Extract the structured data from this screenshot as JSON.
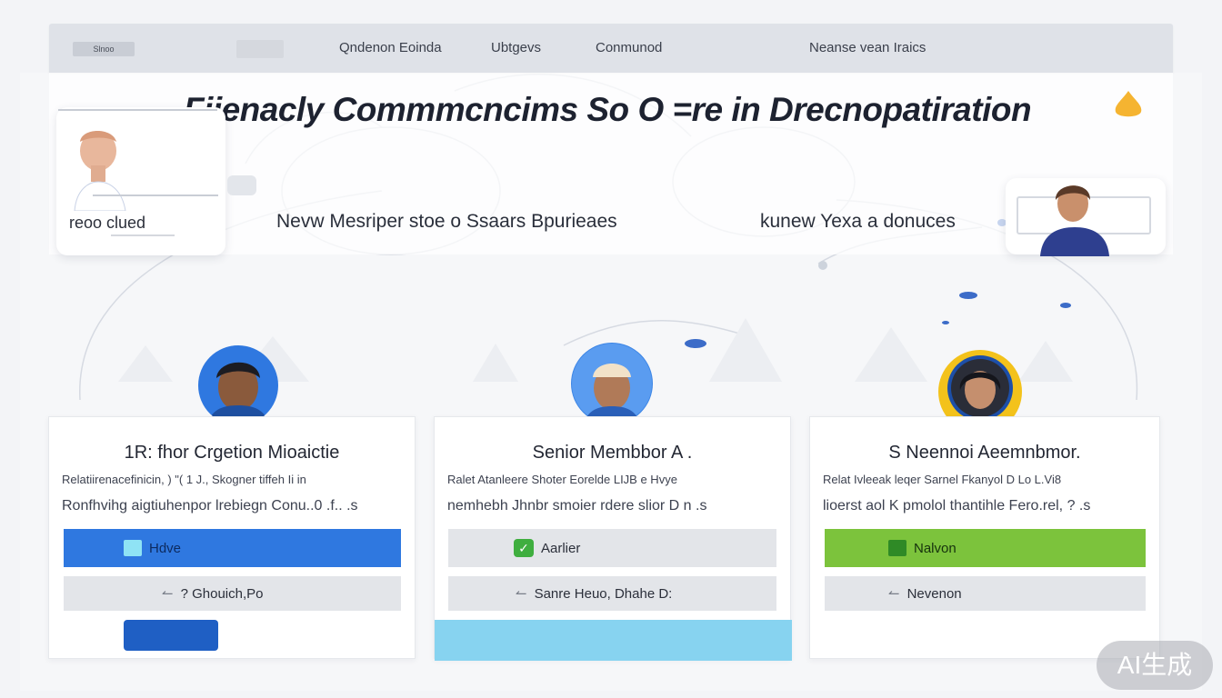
{
  "nav": {
    "logo_text": "Slnoo",
    "links": [
      "Qndenon Eoinda",
      "Ubtgevs",
      "Conmunod",
      "Neanse vean Iraics"
    ]
  },
  "hero": {
    "title": "Fiienacly Commmcncims So  O =re in Drecnopatiration",
    "left_card_label": "reoo clued",
    "subtitle_left": "Nevw Mesriper stoe o Ssaars Bpurieaes",
    "subtitle_right": "kunew Yexa a donuces"
  },
  "cards": [
    {
      "title": "1R: fhor Crgetion Mioaictie",
      "line1": "Relatiirenacefinicin, ) \"( 1 J., Skogner tiffeh  Ii in",
      "line2": "Ronfhvihg aigtiuhenpor lrebiegn Conu..0 .f.. .s",
      "primary_label": "Hdve",
      "secondary_label": "? Ghouich,Po"
    },
    {
      "title": "Senior Membbor A  .",
      "line1": "Ralet Atanleere Shoter Eorelde LIJB e Hvye",
      "line2": "nemhebh Jhnbr smoier rdere slior D n .s",
      "primary_label": "Aarlier",
      "secondary_label": "Sanre Heuo, Dhahe  D:"
    },
    {
      "title": "S  Neennoi Aeemnbmor.",
      "line1": "Relat Ivleeak leqer Sarnel Fkanyol D Lo L.Vi8",
      "line2": "lioerst aol K pmolol thantihle Fero.rel, ? .s",
      "primary_label": "Nalvon",
      "secondary_label": "Nevenon"
    }
  ],
  "watermark": "AI生成",
  "colors": {
    "primary_blue": "#2f78e0",
    "primary_green": "#7cc33c",
    "accent_cyan": "#87d3f0",
    "dark_blue_button": "#1f5fc4",
    "amber": "#f5b431"
  },
  "icons": [
    "checkbox-icon",
    "check-icon",
    "arrow-icon",
    "drop-icon"
  ]
}
